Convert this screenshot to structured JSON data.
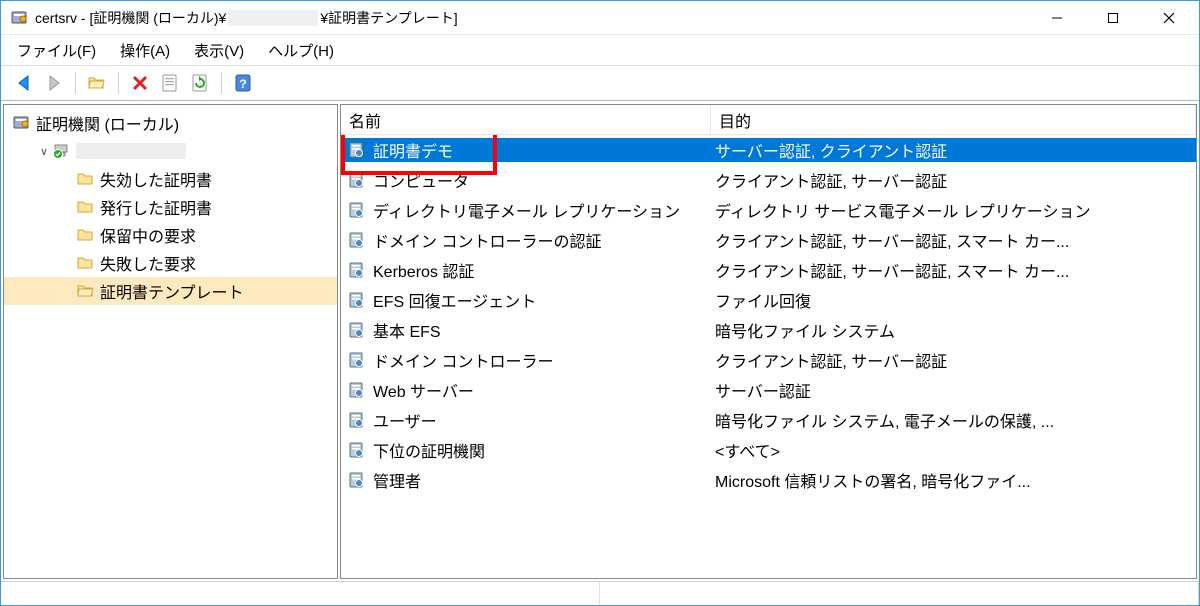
{
  "window": {
    "title_prefix": "certsrv - [証明機関 (ローカル)¥",
    "title_suffix": "¥証明書テンプレート]"
  },
  "menu": {
    "file": "ファイル(F)",
    "action": "操作(A)",
    "view": "表示(V)",
    "help": "ヘルプ(H)"
  },
  "tree": {
    "root": "証明機関 (ローカル)",
    "items": [
      {
        "label": "失効した証明書"
      },
      {
        "label": "発行した証明書"
      },
      {
        "label": "保留中の要求"
      },
      {
        "label": "失敗した要求"
      },
      {
        "label": "証明書テンプレート"
      }
    ]
  },
  "list": {
    "columns": {
      "name": "名前",
      "purpose": "目的"
    },
    "rows": [
      {
        "name": "証明書デモ",
        "purpose": "サーバー認証, クライアント認証",
        "selected": true,
        "highlight": true
      },
      {
        "name": "コンピュータ",
        "purpose": "クライアント認証, サーバー認証"
      },
      {
        "name": "ディレクトリ電子メール レプリケーション",
        "purpose": "ディレクトリ サービス電子メール レプリケーション"
      },
      {
        "name": "ドメイン コントローラーの認証",
        "purpose": "クライアント認証, サーバー認証, スマート カー..."
      },
      {
        "name": "Kerberos 認証",
        "purpose": "クライアント認証, サーバー認証, スマート カー..."
      },
      {
        "name": "EFS 回復エージェント",
        "purpose": "ファイル回復"
      },
      {
        "name": "基本 EFS",
        "purpose": "暗号化ファイル システム"
      },
      {
        "name": "ドメイン コントローラー",
        "purpose": "クライアント認証, サーバー認証"
      },
      {
        "name": "Web サーバー",
        "purpose": "サーバー認証"
      },
      {
        "name": "ユーザー",
        "purpose": "暗号化ファイル システム, 電子メールの保護, ..."
      },
      {
        "name": "下位の証明機関",
        "purpose": "<すべて>"
      },
      {
        "name": "管理者",
        "purpose": "Microsoft 信頼リストの署名, 暗号化ファイ..."
      }
    ]
  }
}
